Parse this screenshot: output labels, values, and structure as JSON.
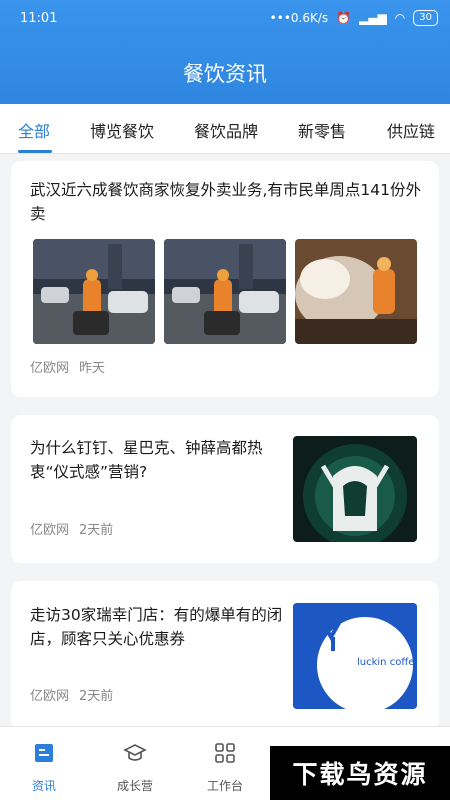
{
  "status_bar": {
    "time": "11:01",
    "speed": "0.6K/s",
    "battery": "30"
  },
  "header": {
    "title": "餐饮资讯"
  },
  "tabs": [
    "全部",
    "博览餐饮",
    "餐饮品牌",
    "新零售",
    "供应链"
  ],
  "articles": [
    {
      "title": "武汉近六成餐饮商家恢复外卖业务,有市民单周点141份外卖",
      "source": "亿欧网",
      "time": "昨天"
    },
    {
      "title": "为什么钉钉、星巴克、钟薛高都热衷“仪式感”营销?",
      "source": "亿欧网",
      "time": "2天前"
    },
    {
      "title": "走访30家瑞幸门店：有的爆单有的闭店，顾客只关心优惠券",
      "source": "亿欧网",
      "time": "2天前",
      "thumb_text": "luckin coffee"
    }
  ],
  "bottom_nav": {
    "items": [
      "资讯",
      "成长营",
      "工作台"
    ]
  },
  "watermark": "下载鸟资源",
  "colors": {
    "accent": "#2b7fd9",
    "header": "#3a94ec"
  }
}
